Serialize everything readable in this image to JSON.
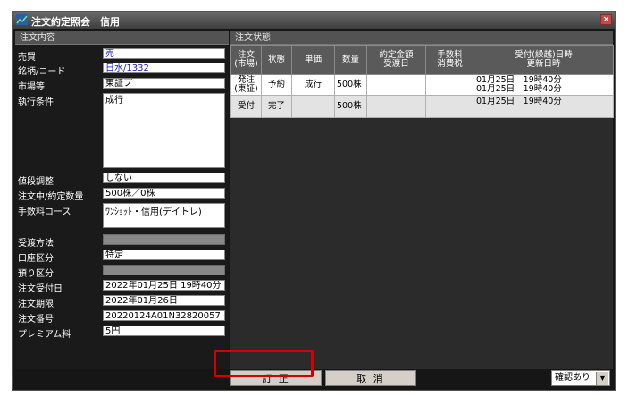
{
  "window": {
    "title": "注文約定照会　信用",
    "close_glyph": "×"
  },
  "left": {
    "section_title": "注文内容",
    "fields": {
      "baibai": {
        "label": "売買",
        "value": "売"
      },
      "meigara": {
        "label": "銘柄/コード",
        "value": "日水/1332"
      },
      "shijo": {
        "label": "市場等",
        "value": "東証プ"
      },
      "shikko": {
        "label": "執行条件",
        "value": "成行"
      },
      "nedan": {
        "label": "値段調整",
        "value": "しない"
      },
      "suryo": {
        "label": "注文中/約定数量",
        "value": "500株／0株"
      },
      "tesuryo": {
        "label": "手数料コース",
        "value": "ﾜﾝｼｮｯﾄ・信用(デイトレ)"
      },
      "ukewatashi": {
        "label": "受渡方法",
        "value": ""
      },
      "koza": {
        "label": "口座区分",
        "value": "特定"
      },
      "azukari": {
        "label": "預り区分",
        "value": ""
      },
      "uketsuke": {
        "label": "注文受付日",
        "value": "2022年01月25日 19時40分"
      },
      "kigen": {
        "label": "注文期限",
        "value": "2022年01月26日"
      },
      "bango": {
        "label": "注文番号",
        "value": "20220124A01N32820057"
      },
      "premium": {
        "label": "プレミアム料",
        "value": "5円"
      }
    }
  },
  "right": {
    "section_title": "注文状態",
    "headers": {
      "chumon_a": "注文",
      "chumon_b": "(市場)",
      "jotai": "状態",
      "tanka": "単価",
      "suryo": "数量",
      "yakujo_a": "約定金額",
      "yakujo_b": "受渡日",
      "tesu_a": "手数料",
      "tesu_b": "消費税",
      "uke_a": "受付(繰越)日時",
      "uke_b": "更新日時"
    },
    "rows": [
      {
        "chumon_a": "発注",
        "chumon_b": "(東証)",
        "jotai": "予約",
        "tanka": "成行",
        "suryo": "500株",
        "yakujo": "",
        "tesu": "",
        "uke_a": "01月25日　19時40分",
        "uke_b": "01月25日　19時40分"
      },
      {
        "chumon_a": "受付",
        "chumon_b": "",
        "jotai": "完了",
        "tanka": "",
        "suryo": "500株",
        "yakujo": "",
        "tesu": "",
        "uke_a": "01月25日　19時40分",
        "uke_b": ""
      }
    ]
  },
  "footer": {
    "teisei": "訂 正",
    "torikeshi": "取 消",
    "confirm_select": "確認あり",
    "arrow_glyph": "▼"
  },
  "colors": {
    "highlight": "#d40000",
    "link_text": "#1a1acc"
  }
}
